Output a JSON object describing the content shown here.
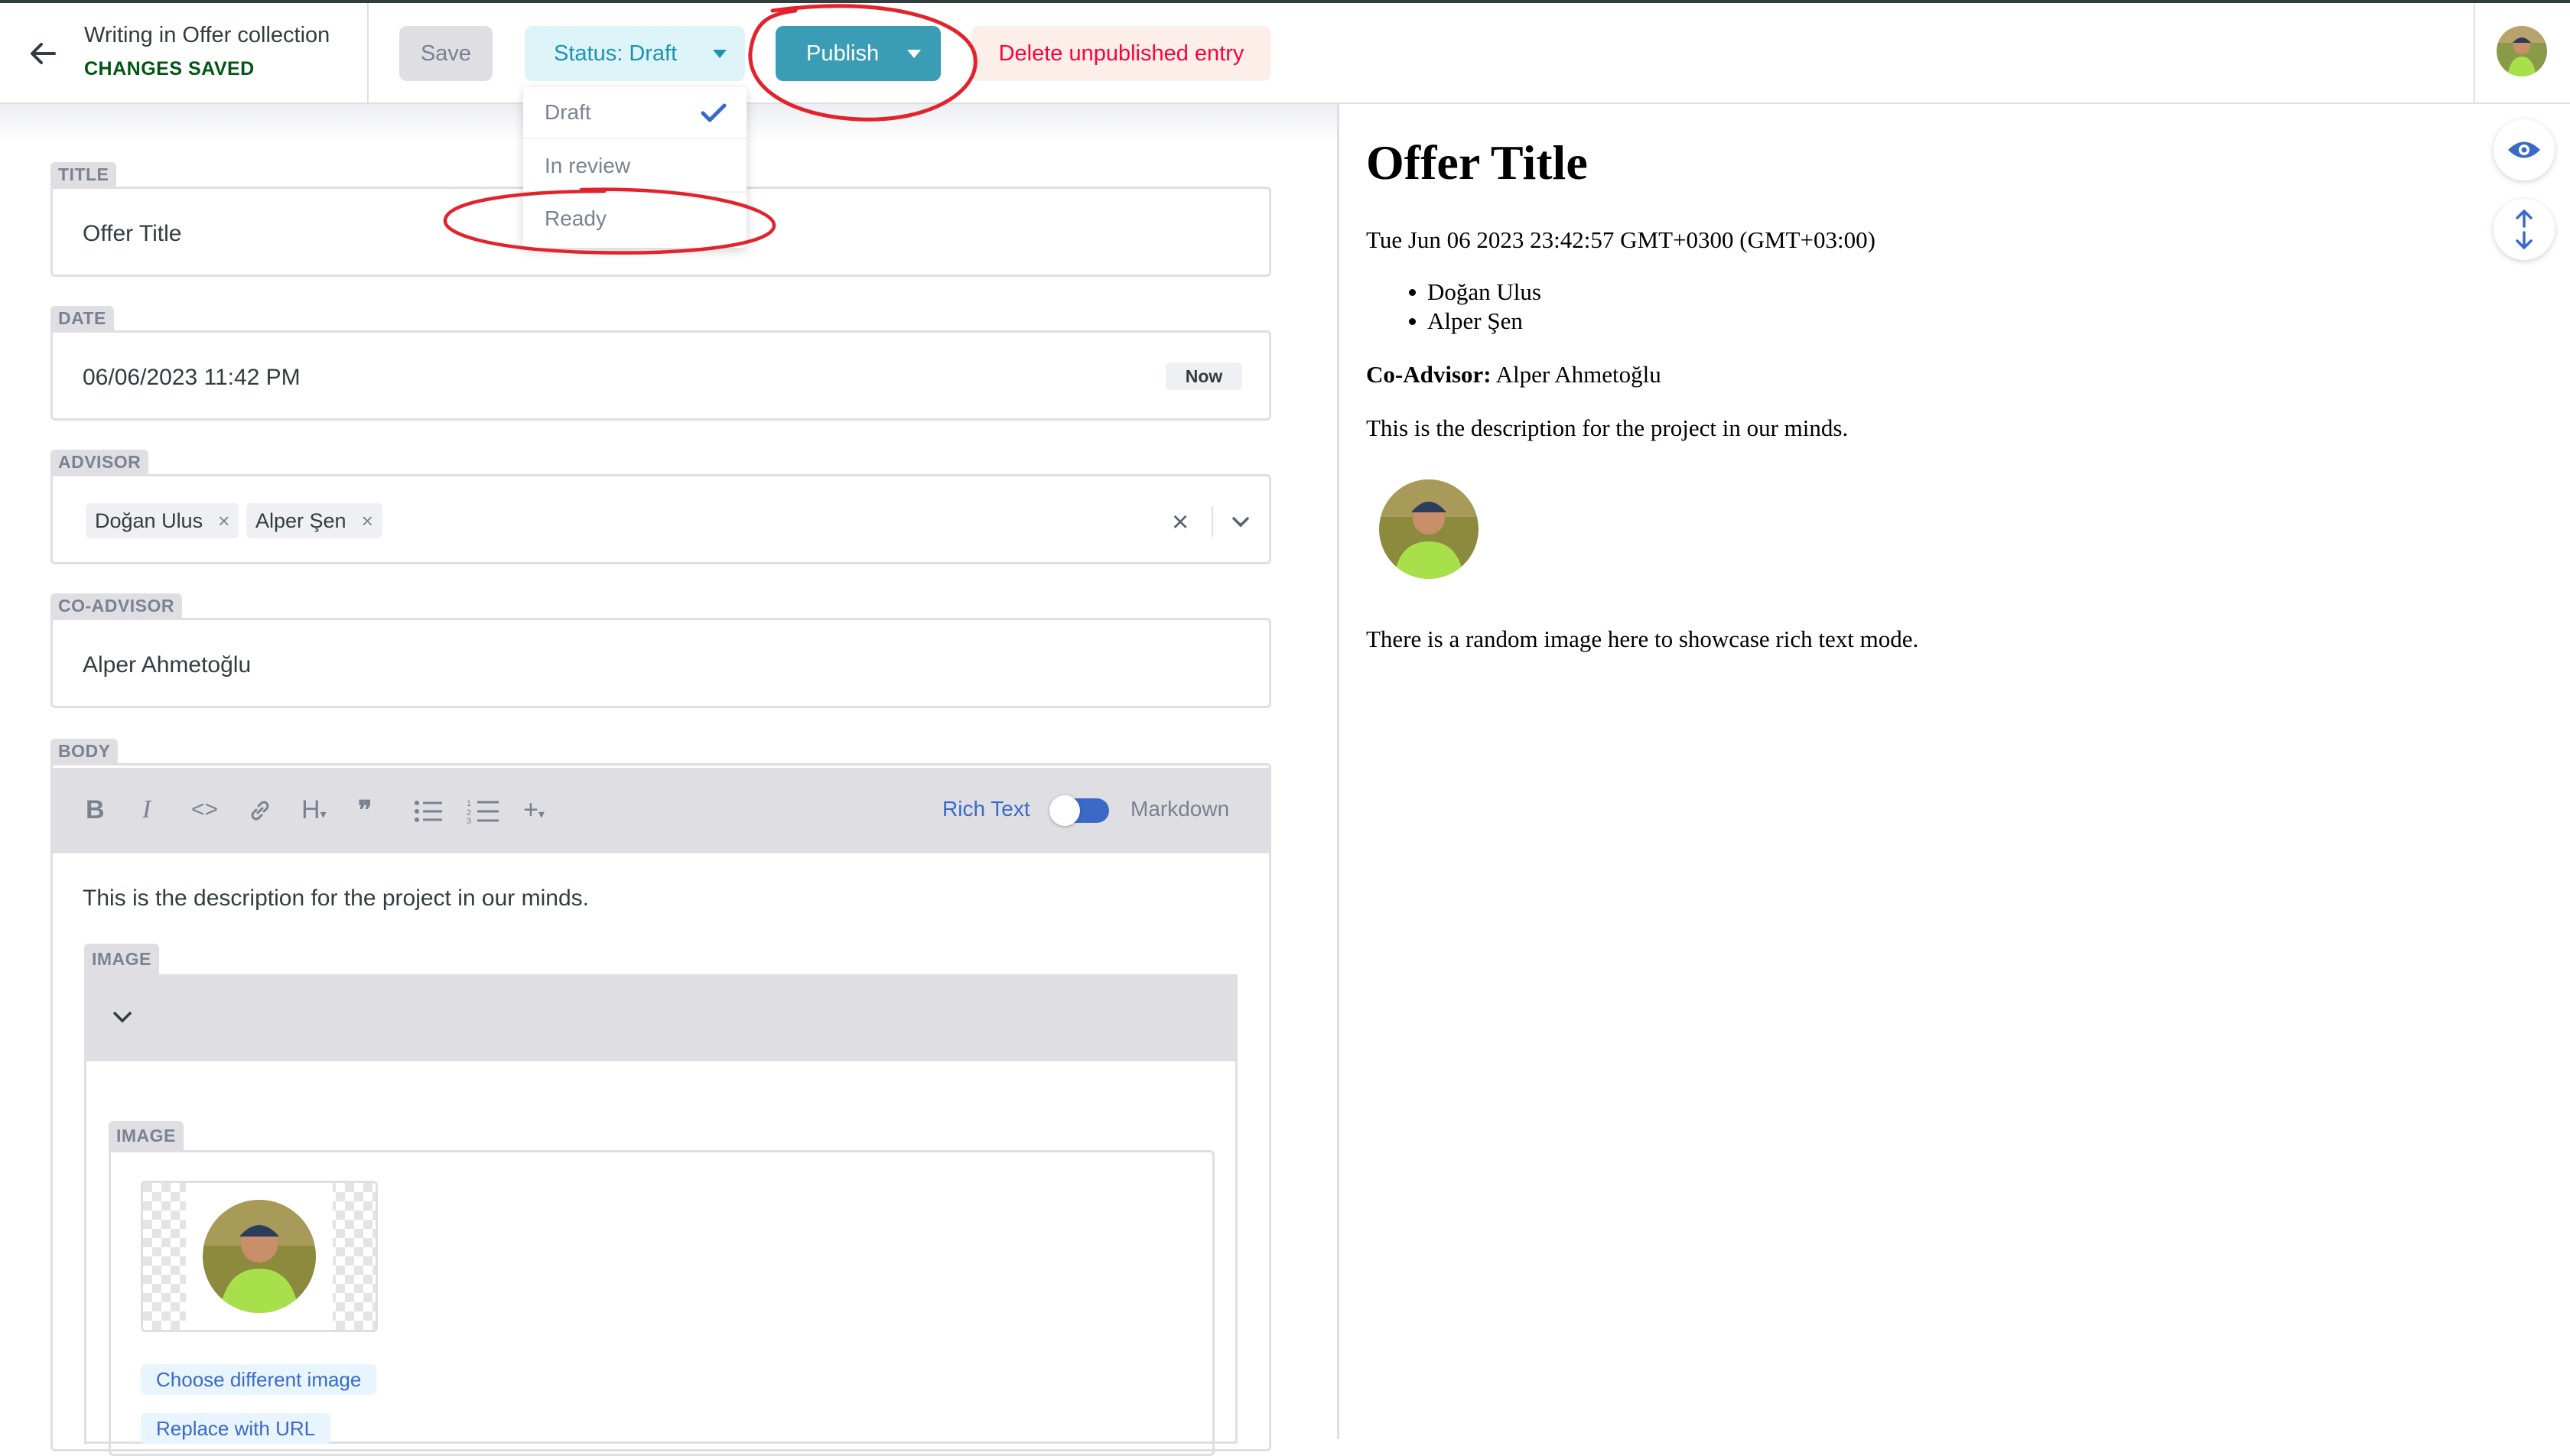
{
  "header": {
    "back_icon": "arrow-left-icon",
    "writing_in": "Writing in Offer collection",
    "save_status": "CHANGES SAVED",
    "save_label": "Save",
    "status_label": "Status: Draft",
    "publish_label": "Publish",
    "delete_label": "Delete unpublished entry"
  },
  "status_menu": {
    "options": [
      "Draft",
      "In review",
      "Ready"
    ],
    "selected": "Draft"
  },
  "fields": {
    "title": {
      "label": "TITLE",
      "value": "Offer Title"
    },
    "date": {
      "label": "DATE",
      "value": "06/06/2023 11:42 PM",
      "now_label": "Now"
    },
    "advisor": {
      "label": "ADVISOR",
      "chips": [
        "Doğan Ulus",
        "Alper Şen"
      ],
      "chip_remove": "×",
      "clear": "×"
    },
    "co_advisor": {
      "label": "CO-ADVISOR",
      "value": "Alper Ahmetoğlu"
    },
    "body": {
      "label": "BODY",
      "toolbar": {
        "bold": "B",
        "italic": "I",
        "code": "<>",
        "heading": "H",
        "quote": "❞",
        "bulleted_list": "☰",
        "numbered_list": "☰",
        "add": "+",
        "rich_text": "Rich Text",
        "markdown": "Markdown"
      },
      "text": "This is the description for the project in our minds.",
      "image_block": {
        "label": "IMAGE",
        "inner_label": "IMAGE",
        "choose_label": "Choose different image",
        "replace_label": "Replace with URL"
      }
    }
  },
  "preview": {
    "title": "Offer Title",
    "date": "Tue Jun 06 2023 23:42:57 GMT+0300 (GMT+03:00)",
    "advisors": [
      "Doğan Ulus",
      "Alper Şen"
    ],
    "co_advisor_label": "Co-Advisor:",
    "co_advisor_value": "Alper Ahmetoğlu",
    "description": "This is the description for the project in our minds.",
    "image_caption": "There is a random image here to showcase rich text mode."
  },
  "side_controls": {
    "preview_icon": "eye-icon",
    "sync_scroll_icon": "sync-scroll-icon"
  },
  "colors": {
    "publish": "#3a9db5",
    "status": "#1b94b2",
    "delete": "#ff003b",
    "saved": "#005614",
    "accent": "#3a69c7",
    "annotation": "#e3232b"
  }
}
